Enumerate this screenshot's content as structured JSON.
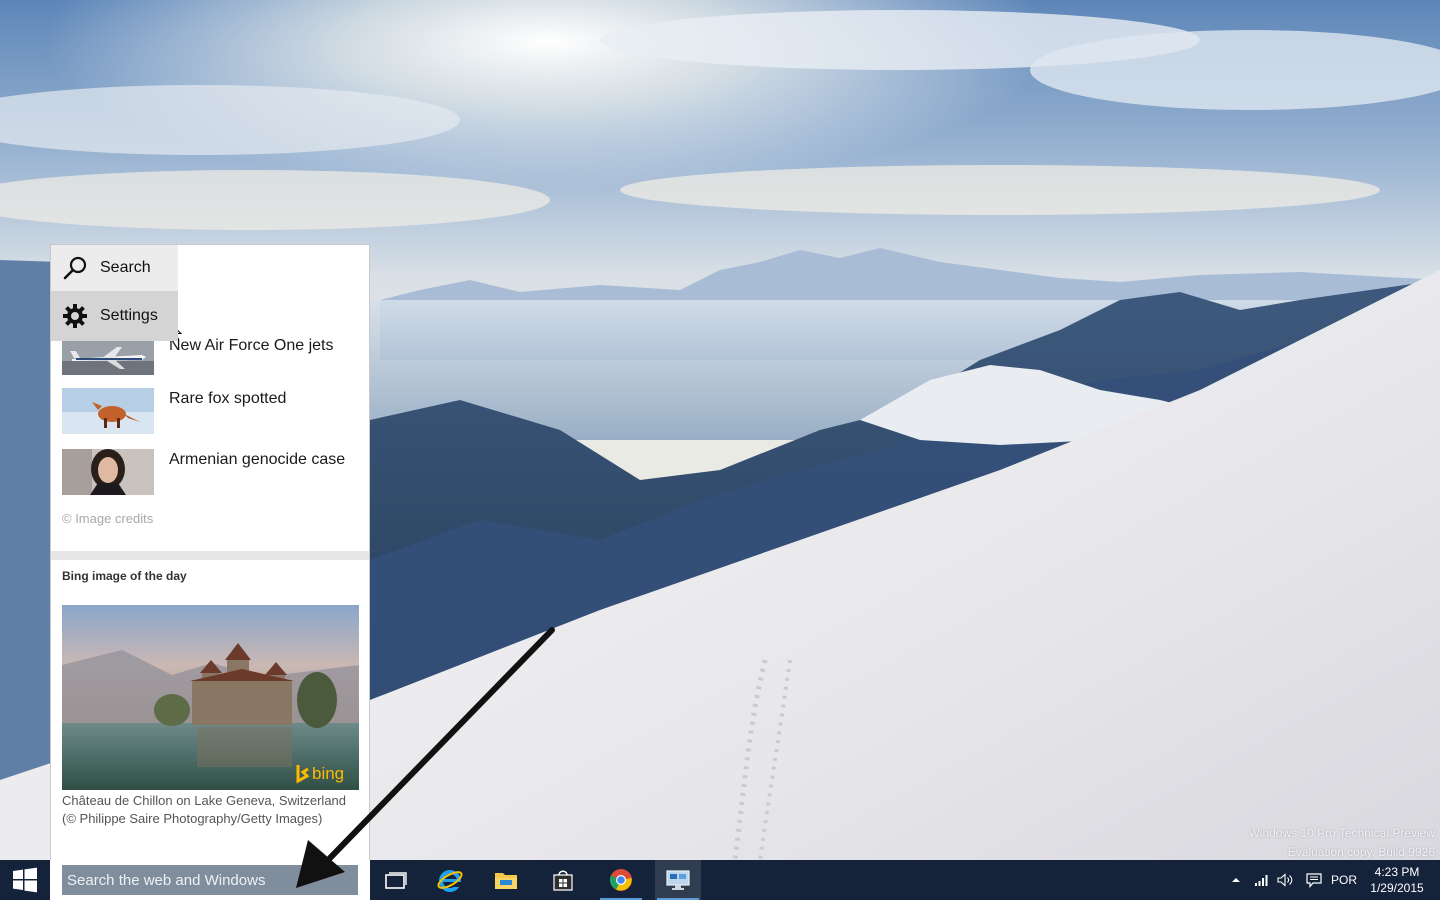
{
  "search_panel": {
    "menu": [
      {
        "label": "Search",
        "icon": "magnifier-icon"
      },
      {
        "label": "Settings",
        "icon": "gear-icon"
      }
    ],
    "news": [
      {
        "title": "New Air Force One jets",
        "thumb": "airplane-thumbnail"
      },
      {
        "title": "Rare fox spotted",
        "thumb": "fox-in-snow-thumbnail"
      },
      {
        "title": "Armenian genocide case",
        "thumb": "woman-portrait-thumbnail"
      }
    ],
    "image_credits": "© Image credits",
    "bing_heading": "Bing image of the day",
    "bing_logo": "bing",
    "bing_caption": "Château de Chillon on Lake Geneva, Switzerland (© Philippe Saire Photography/Getty Images)"
  },
  "taskbar": {
    "search_placeholder": "Search the web and Windows",
    "apps": [
      {
        "name": "Task View",
        "icon": "task-view-icon",
        "running": false
      },
      {
        "name": "Internet Explorer",
        "icon": "internet-explorer-icon",
        "running": false
      },
      {
        "name": "File Explorer",
        "icon": "file-explorer-icon",
        "running": false
      },
      {
        "name": "Store",
        "icon": "store-icon",
        "running": false
      },
      {
        "name": "Google Chrome",
        "icon": "chrome-icon",
        "running": true
      },
      {
        "name": "Remote Desktop",
        "icon": "remote-desktop-icon",
        "running": true,
        "active": true
      }
    ],
    "tray": {
      "language": "POR",
      "time": "4:23 PM",
      "date": "1/29/2015"
    }
  },
  "watermark": {
    "line1": "Windows 10 Pro Technical Preview",
    "line2": "Evaluation copy. Build 9926"
  },
  "colors": {
    "taskbar": "#14233a",
    "search_input": "#7f8d9d",
    "accent": "#5b9bd5",
    "bing_yellow": "#ffb900"
  }
}
